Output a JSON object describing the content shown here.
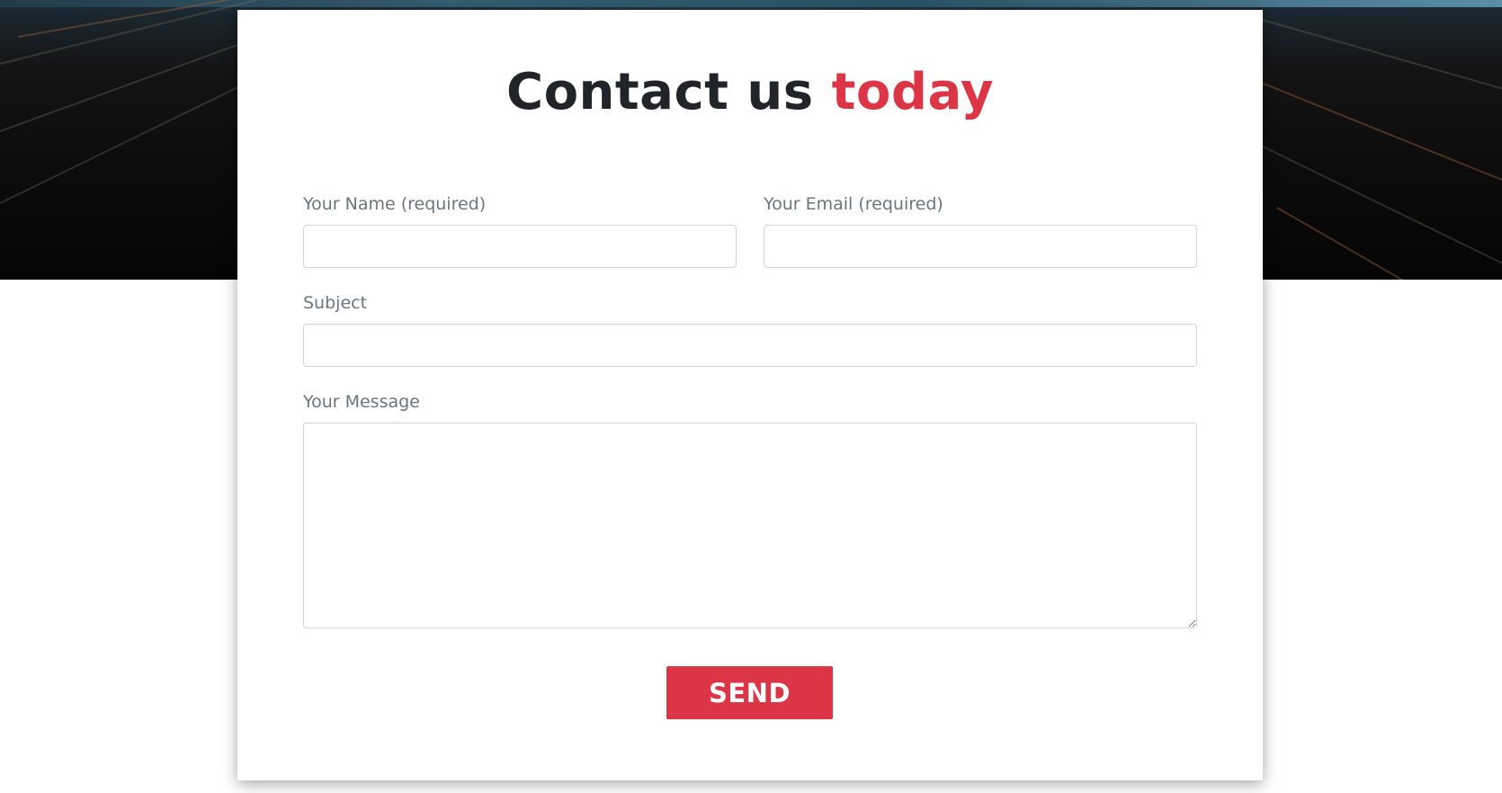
{
  "header": {
    "title_main": "Contact us",
    "title_accent": "today"
  },
  "form": {
    "name": {
      "label": "Your Name (required)",
      "value": "",
      "placeholder": ""
    },
    "email": {
      "label": "Your Email (required)",
      "value": "",
      "placeholder": ""
    },
    "subject": {
      "label": "Subject",
      "value": "",
      "placeholder": ""
    },
    "message": {
      "label": "Your Message",
      "value": "",
      "placeholder": ""
    },
    "submit_label": "SEND"
  },
  "colors": {
    "accent": "#dc3545",
    "heading": "#212529",
    "label": "#6c757d",
    "input_border": "#ced4da",
    "background": "#ffffff"
  },
  "icons": {
    "textarea_resize": "resize-handle-icon"
  }
}
